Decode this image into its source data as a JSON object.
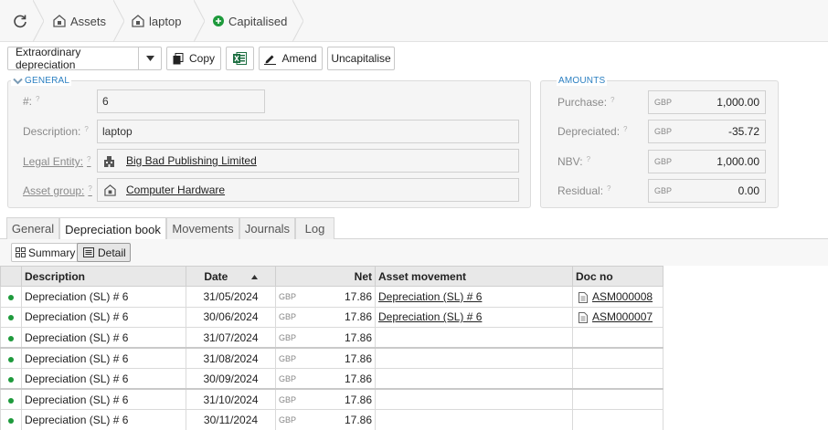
{
  "breadcrumb": {
    "assets": "Assets",
    "item": "laptop",
    "status": "Capitalised",
    "status_color": "#1e9a3c"
  },
  "toolbar": {
    "action_select": "Extraordinary depreciation",
    "copy": "Copy",
    "amend": "Amend",
    "uncapitalise": "Uncapitalise"
  },
  "general": {
    "legend": "GENERAL",
    "number_label": "#:",
    "number": "6",
    "description_label": "Description:",
    "description": "laptop",
    "legal_entity_label": "Legal Entity:",
    "legal_entity": "Big Bad Publishing Limited",
    "asset_group_label": "Asset group:",
    "asset_group": "Computer Hardware"
  },
  "amounts": {
    "legend": "AMOUNTS",
    "purchase_label": "Purchase:",
    "purchase_cur": "GBP",
    "purchase": "1,000.00",
    "depreciated_label": "Depreciated:",
    "depreciated_cur": "GBP",
    "depreciated": "-35.72",
    "nbv_label": "NBV:",
    "nbv_cur": "GBP",
    "nbv": "1,000.00",
    "residual_label": "Residual:",
    "residual_cur": "GBP",
    "residual": "0.00"
  },
  "tabs": [
    "General",
    "Depreciation book",
    "Movements",
    "Journals",
    "Log"
  ],
  "view": {
    "summary": "Summary",
    "detail": "Detail"
  },
  "grid": {
    "headers": {
      "description": "Description",
      "date": "Date",
      "net": "Net",
      "movement": "Asset movement",
      "doc": "Doc no"
    },
    "rows": [
      {
        "description": "Depreciation (SL) # 6",
        "date": "31/05/2024",
        "cur": "GBP",
        "net": "17.86",
        "movement": "Depreciation (SL) # 6",
        "doc": "ASM000008"
      },
      {
        "description": "Depreciation (SL) # 6",
        "date": "30/06/2024",
        "cur": "GBP",
        "net": "17.86",
        "movement": "Depreciation (SL) # 6",
        "doc": "ASM000007"
      },
      {
        "description": "Depreciation (SL) # 6",
        "date": "31/07/2024",
        "cur": "GBP",
        "net": "17.86",
        "movement": "",
        "doc": ""
      },
      {
        "description": "Depreciation (SL) # 6",
        "date": "31/08/2024",
        "cur": "GBP",
        "net": "17.86",
        "movement": "",
        "doc": ""
      },
      {
        "description": "Depreciation (SL) # 6",
        "date": "30/09/2024",
        "cur": "GBP",
        "net": "17.86",
        "movement": "",
        "doc": ""
      },
      {
        "description": "Depreciation (SL) # 6",
        "date": "31/10/2024",
        "cur": "GBP",
        "net": "17.86",
        "movement": "",
        "doc": ""
      },
      {
        "description": "Depreciation (SL) # 6",
        "date": "30/11/2024",
        "cur": "GBP",
        "net": "17.86",
        "movement": "",
        "doc": ""
      }
    ]
  }
}
